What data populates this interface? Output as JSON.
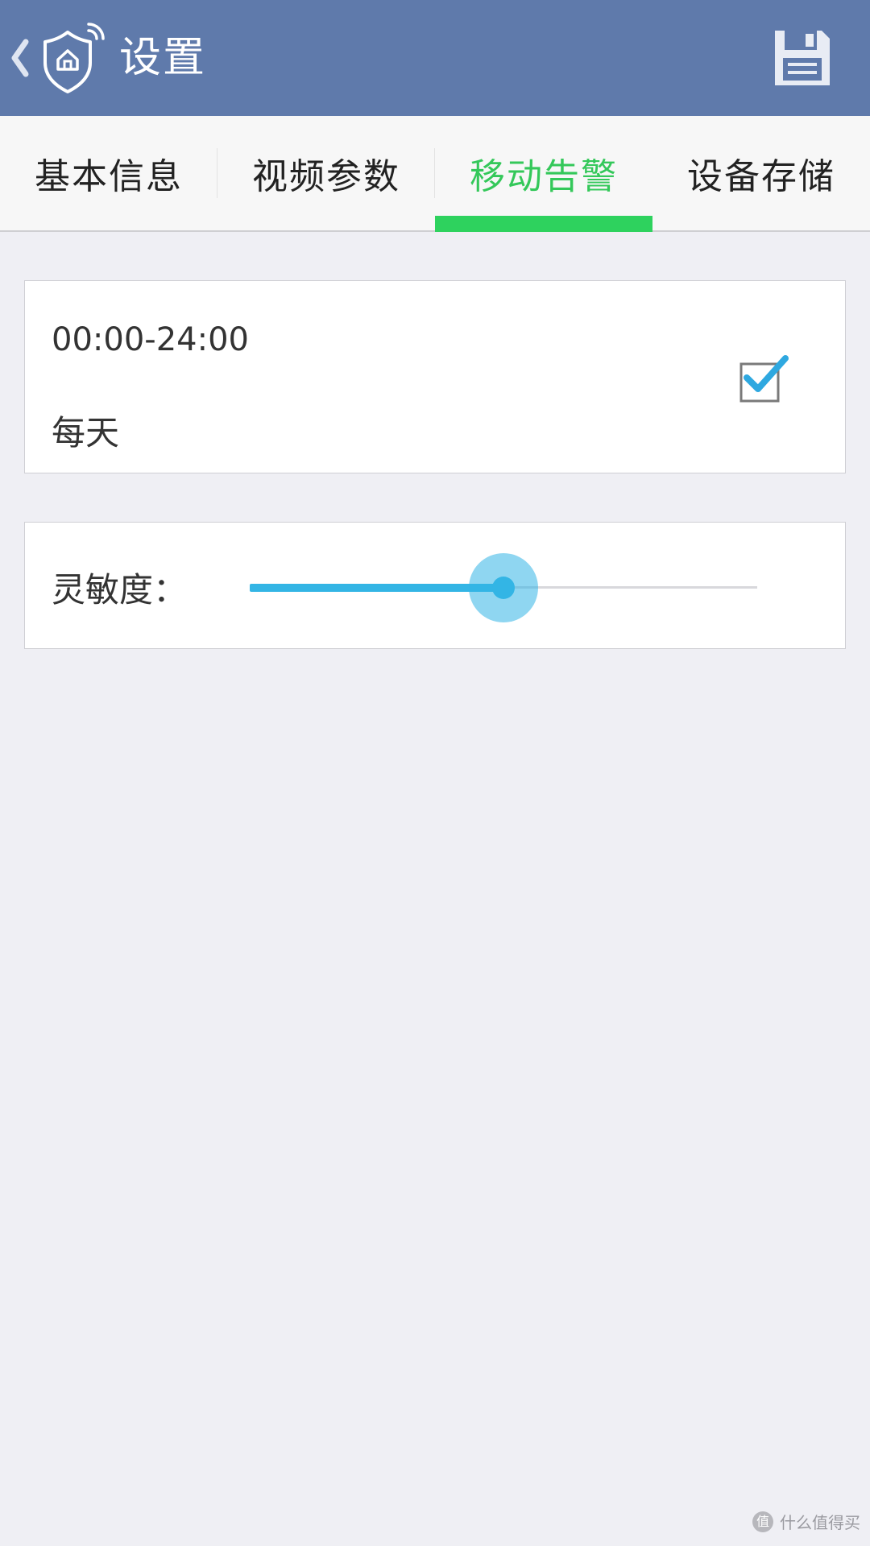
{
  "header": {
    "title": "设置",
    "back_icon": "chevron-left-icon",
    "logo_icon": "home-shield-wifi-icon",
    "save_icon": "floppy-disk-icon",
    "bar_color": "#5f7aab"
  },
  "tabs": [
    {
      "label": "基本信息",
      "active": false
    },
    {
      "label": "视频参数",
      "active": false
    },
    {
      "label": "移动告警",
      "active": true
    },
    {
      "label": "设备存储",
      "active": false
    }
  ],
  "tab_active_color": "#2ed25e",
  "schedule": {
    "time_range": "00:00-24:00",
    "repeat": "每天",
    "enabled": true
  },
  "sensitivity": {
    "label": "灵敏度：",
    "value": 0.5,
    "accent_color": "#33b5e5"
  },
  "watermark": {
    "text": "什么值得买",
    "icon_text": "值"
  }
}
